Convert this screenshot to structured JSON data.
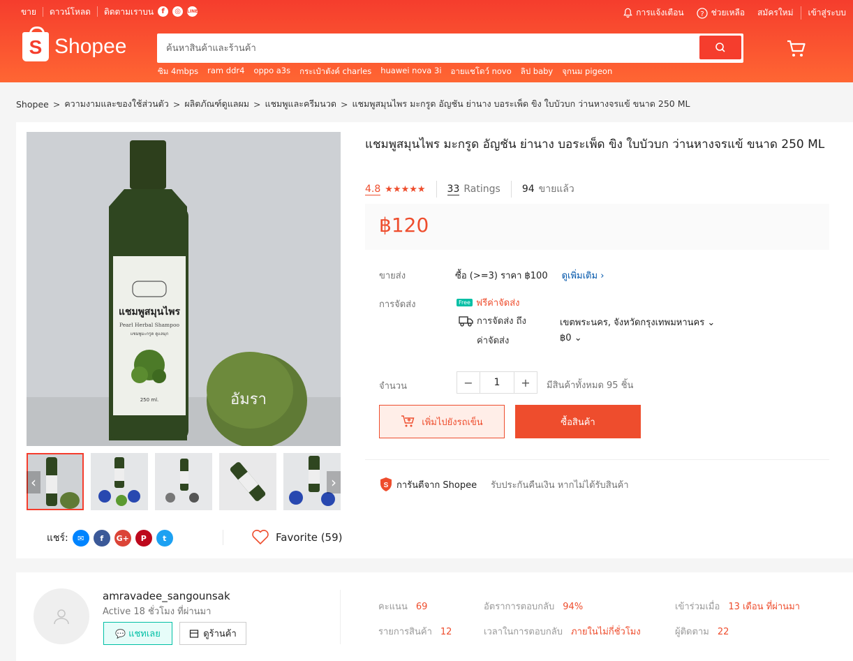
{
  "header": {
    "topbar_left": [
      "ขาย",
      "ดาวน์โหลด",
      "ติดตามเราบน"
    ],
    "topbar_right": {
      "notifications": "การแจ้งเตือน",
      "help": "ช่วยเหลือ",
      "signup": "สมัครใหม่",
      "login": "เข้าสู่ระบบ"
    },
    "logo_text": "Shopee",
    "search_placeholder": "ค้นหาสินค้าและร้านค้า",
    "suggestions": [
      "ซิม 4mbps",
      "ram ddr4",
      "oppo a3s",
      "กระเป๋าตังค์ charles",
      "huawei nova 3i",
      "อายแชโดว์ novo",
      "ลิป baby",
      "จุกนม pigeon"
    ]
  },
  "breadcrumb": [
    "Shopee",
    "ความงามและของใช้ส่วนตัว",
    "ผลิตภัณฑ์ดูแลผม",
    "แชมพูและครีมนวด",
    "แชมพูสมุนไพร มะกรูด อัญชัน ย่านาง บอระเพ็ด ขิง ใบบัวบก ว่านหางจรแข้ ขนาด 250 ML"
  ],
  "product": {
    "title": "แชมพูสมุนไพร มะกรูด อัญชัน ย่านาง บอระเพ็ด ขิง ใบบัวบก ว่านหางจรแข้ ขนาด 250 ML",
    "rating": "4.8",
    "stars": "★★★★★",
    "ratings_count": "33",
    "ratings_label": "Ratings",
    "sold_count": "94",
    "sold_label": "ขายแล้ว",
    "price": "฿120",
    "image_label_thai": "แชมพูสมุนไพร",
    "image_label_en": "Pearl Herbal Shampoo",
    "image_label_sub": "แชมพูมะกรูด ดูแลมุก",
    "image_volume": "250 ml.",
    "image_watermark": "อัมรา",
    "wholesale_label": "ขายส่ง",
    "wholesale_value": "ซื้อ (>=3) ราคา ฿100",
    "wholesale_more": "ดูเพิ่มเติม",
    "shipping_label": "การจัดส่ง",
    "free_badge": "Free",
    "free_shipping": "ฟรีค่าจัดส่ง",
    "ship_to_label": "การจัดส่ง ถึง",
    "ship_to_value": "เขตพระนคร, จังหวัดกรุงเทพมหานคร",
    "ship_fee_label": "ค่าจัดส่ง",
    "ship_fee_value": "฿0",
    "qty_label": "จำนวน",
    "qty_value": "1",
    "stock_text": "มีสินค้าทั้งหมด 95 ชิ้น",
    "add_to_cart": "เพิ่มไปยังรถเข็น",
    "buy_now": "ซื้อสินค้า",
    "guarantee_title": "การันตีจาก Shopee",
    "guarantee_text": "รับประกันคืนเงิน หากไม่ได้รับสินค้า",
    "share_label": "แชร์:",
    "favorite": "Favorite (59)"
  },
  "shop": {
    "name": "amravadee_sangounsak",
    "active": "Active 18 ชั่วโมง ที่ผ่านมา",
    "chat": "แชทเลย",
    "view_shop": "ดูร้านค้า",
    "stats": {
      "score_label": "คะแนน",
      "score": "69",
      "items_label": "รายการสินค้า",
      "items": "12",
      "resp_rate_label": "อัตราการตอบกลับ",
      "resp_rate": "94%",
      "resp_time_label": "เวลาในการตอบกลับ",
      "resp_time": "ภายในไม่กี่ชั่วโมง",
      "joined_label": "เข้าร่วมเมื่อ",
      "joined": "13 เดือน ที่ผ่านมา",
      "followers_label": "ผู้ติดตาม",
      "followers": "22"
    }
  },
  "colors": {
    "brand": "#ee4d2d",
    "chat": "#00bfa5"
  }
}
